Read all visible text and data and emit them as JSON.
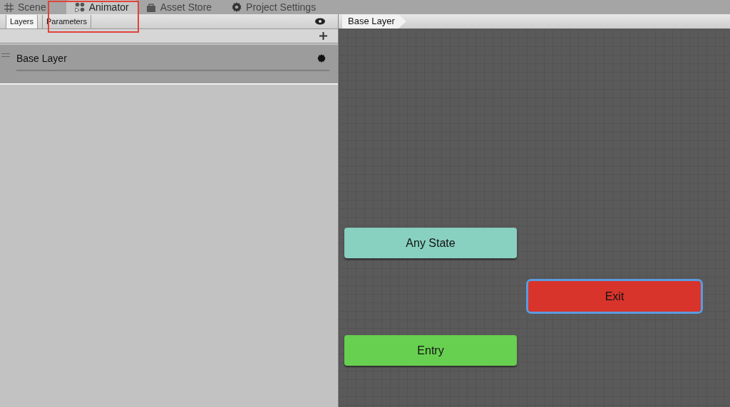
{
  "window_tabs": [
    {
      "label": "Scene",
      "selected": false
    },
    {
      "label": "Animator",
      "selected": true
    },
    {
      "label": "Asset Store",
      "selected": false
    },
    {
      "label": "Project Settings",
      "selected": false
    }
  ],
  "sidebar_tabs": [
    {
      "label": "Layers",
      "selected": true
    },
    {
      "label": "Parameters",
      "selected": false
    }
  ],
  "layers": [
    {
      "name": "Base Layer",
      "selected": true
    }
  ],
  "breadcrumb": [
    "Base Layer"
  ],
  "nodes": [
    {
      "label": "Any State",
      "color": "#88d0c0",
      "selected": false
    },
    {
      "label": "Exit",
      "color": "#d8342c",
      "selected": true
    },
    {
      "label": "Entry",
      "color": "#68d050",
      "selected": false
    }
  ]
}
